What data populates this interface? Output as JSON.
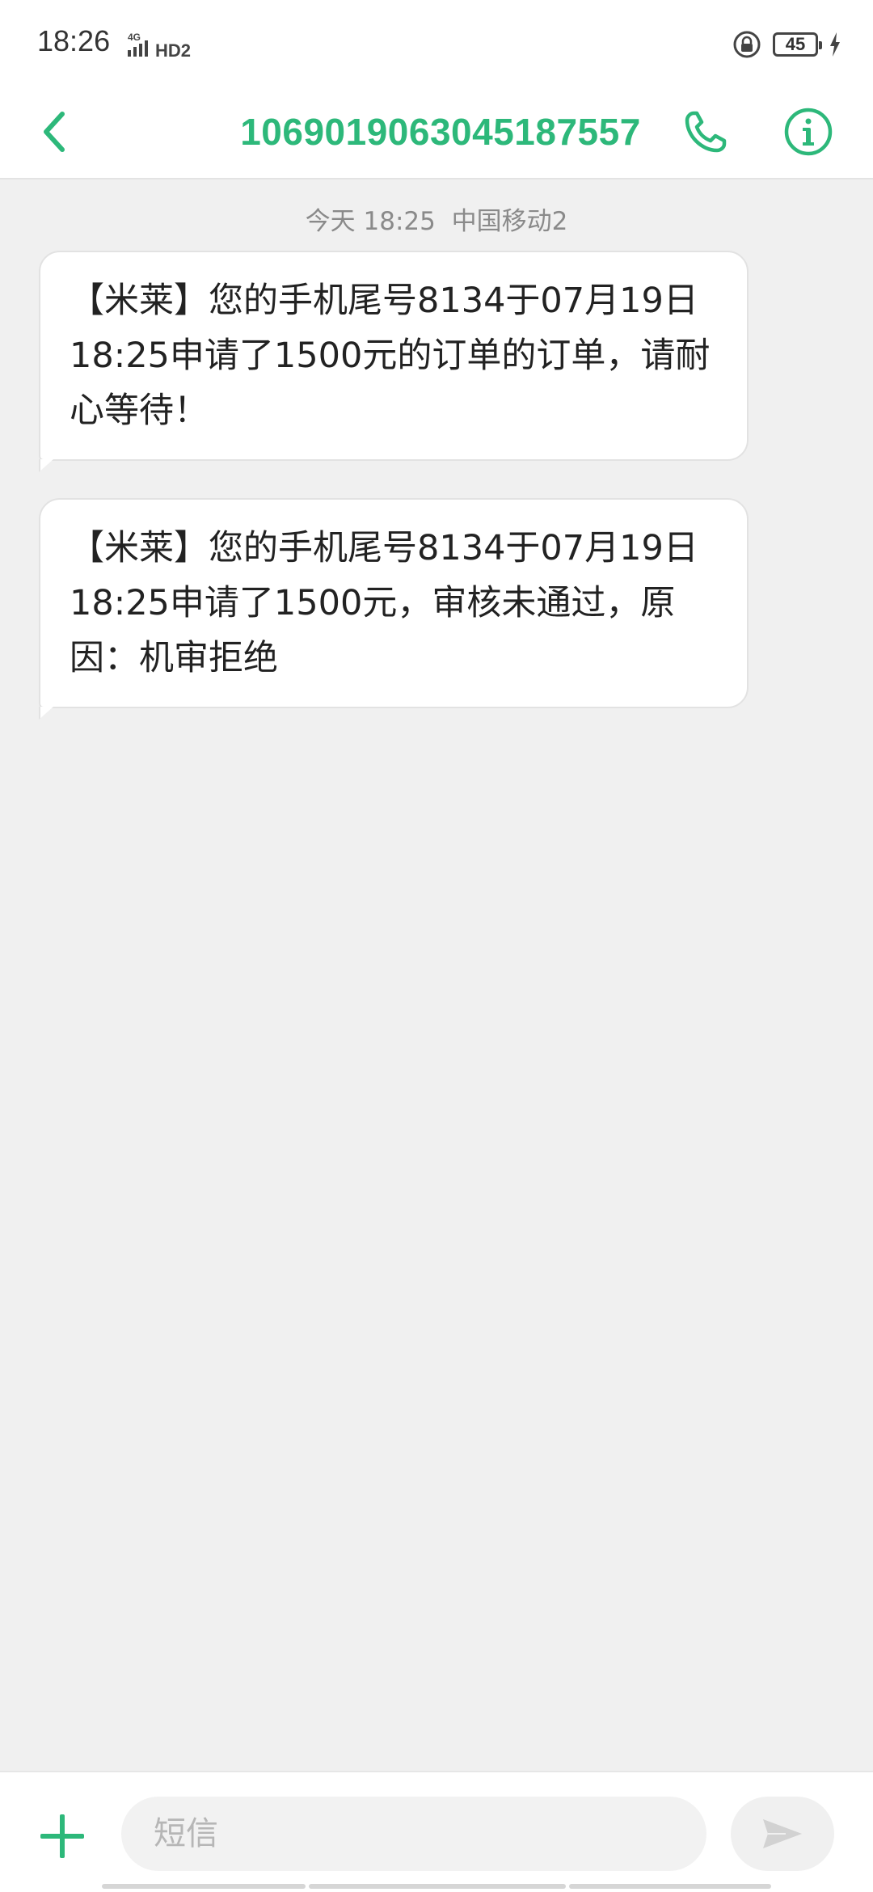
{
  "status_bar": {
    "time": "18:26",
    "network": "4G",
    "hd": "HD2",
    "battery_level": "45"
  },
  "header": {
    "title": "1069019063045187557"
  },
  "conversation": {
    "timestamp": "今天 18:25  中国移动2",
    "messages": [
      {
        "text": "【米莱】您的手机尾号8134于07月19日18:25申请了1500元的订单的订单，请耐心等待！"
      },
      {
        "text": "【米莱】您的手机尾号8134于07月19日18:25申请了1500元，审核未通过，原因：机审拒绝"
      }
    ]
  },
  "composer": {
    "placeholder": "短信"
  },
  "colors": {
    "accent": "#2db87a",
    "background": "#f0f0f0",
    "bubble": "#ffffff",
    "timestamp": "#8a8a8a"
  },
  "icons": {
    "back": "chevron-left-icon",
    "call": "phone-icon",
    "info": "info-icon",
    "add": "plus-icon",
    "send": "send-icon"
  }
}
